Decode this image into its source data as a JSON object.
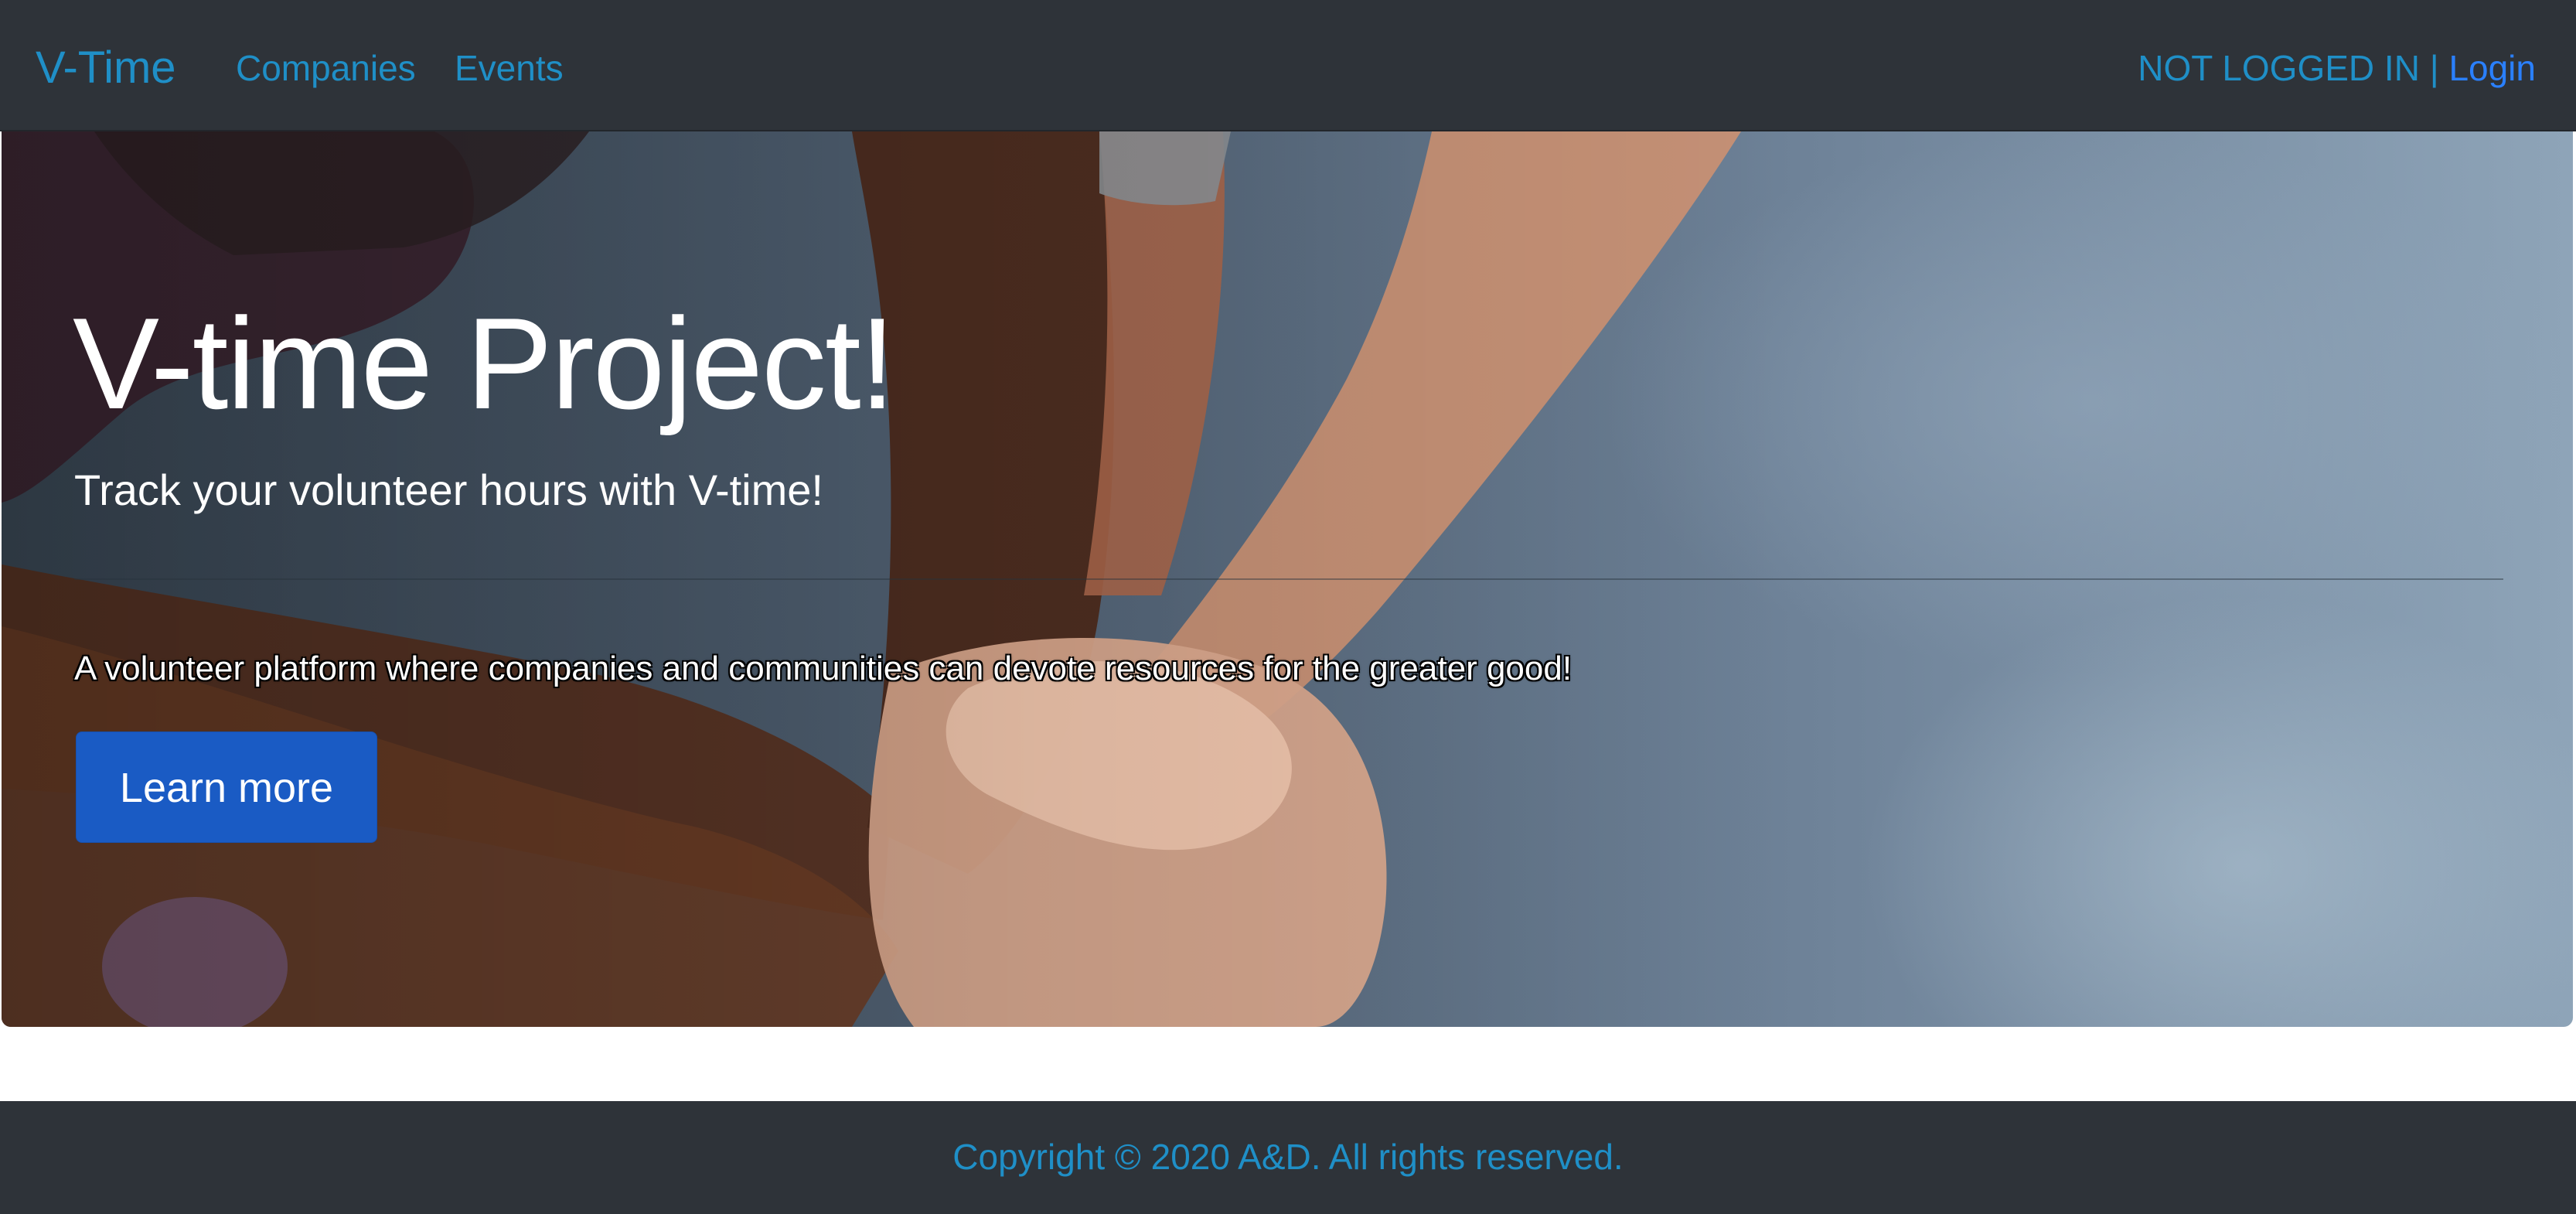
{
  "navbar": {
    "brand": "V-Time",
    "links": [
      {
        "label": "Companies"
      },
      {
        "label": "Events"
      }
    ],
    "auth_status": "NOT LOGGED IN |",
    "login_label": "Login"
  },
  "hero": {
    "title": "V-time Project!",
    "lead": "Track your volunteer hours with V-time!",
    "description": "A volunteer platform where companies and communities can devote resources for the greater good!",
    "button_label": "Learn more"
  },
  "footer": {
    "copyright": "Copyright © 2020 A&D. All rights reserved."
  },
  "colors": {
    "navbar_bg": "#2e3339",
    "link": "#1f8fc7",
    "login_link": "#2a80ff",
    "primary_button": "#1a5bc4"
  }
}
